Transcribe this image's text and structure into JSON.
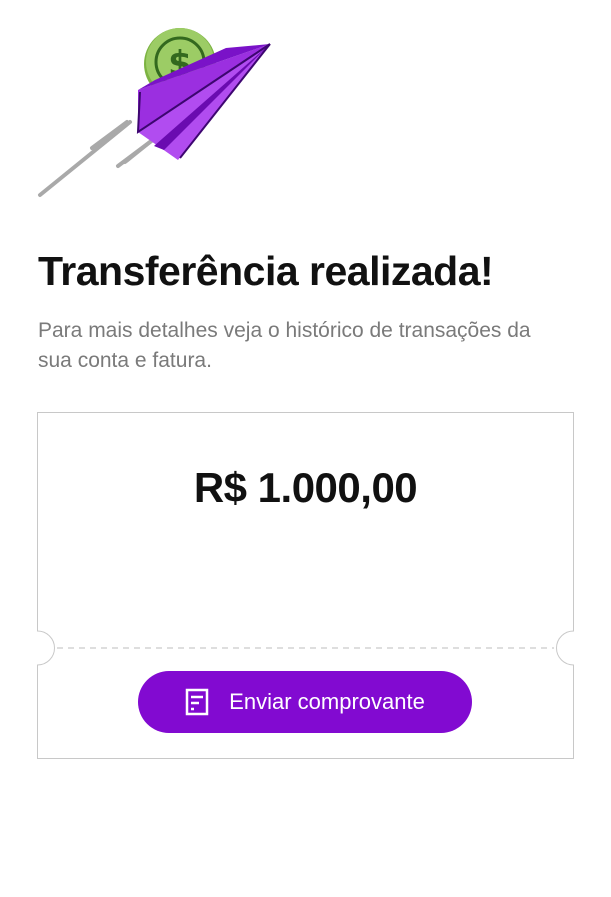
{
  "page": {
    "title": "Transferência realizada!",
    "subtitle": "Para mais detalhes veja o histórico de transações da sua conta e fatura."
  },
  "receipt": {
    "amount": "R$ 1.000,00",
    "send_button_label": "Enviar comprovante",
    "send_button_icon": "receipt-icon"
  },
  "illustration": {
    "icon": "paper-plane-money-icon",
    "coin_symbol": "$"
  },
  "colors": {
    "brand_purple": "#820ad1",
    "coin_green": "#8bc34a",
    "title_text": "#111111",
    "subtitle_text": "#7a7a7a",
    "card_border": "#c8c8c8"
  }
}
